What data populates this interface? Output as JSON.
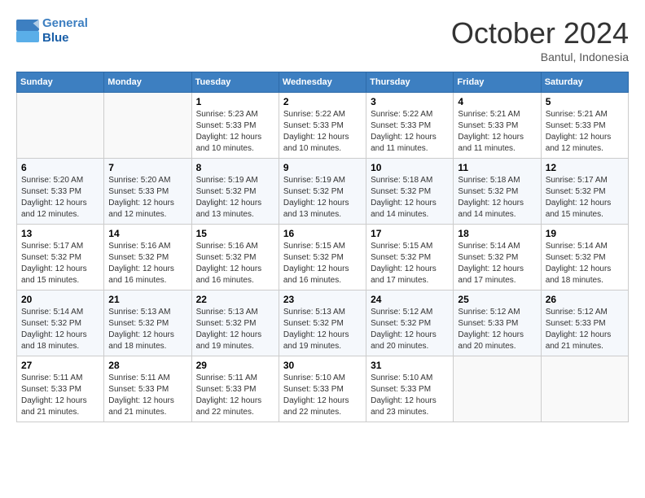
{
  "header": {
    "logo_line1": "General",
    "logo_line2": "Blue",
    "month": "October 2024",
    "location": "Bantul, Indonesia"
  },
  "days_of_week": [
    "Sunday",
    "Monday",
    "Tuesday",
    "Wednesday",
    "Thursday",
    "Friday",
    "Saturday"
  ],
  "weeks": [
    [
      {
        "day": "",
        "sunrise": "",
        "sunset": "",
        "daylight": ""
      },
      {
        "day": "",
        "sunrise": "",
        "sunset": "",
        "daylight": ""
      },
      {
        "day": "1",
        "sunrise": "Sunrise: 5:23 AM",
        "sunset": "Sunset: 5:33 PM",
        "daylight": "Daylight: 12 hours and 10 minutes."
      },
      {
        "day": "2",
        "sunrise": "Sunrise: 5:22 AM",
        "sunset": "Sunset: 5:33 PM",
        "daylight": "Daylight: 12 hours and 10 minutes."
      },
      {
        "day": "3",
        "sunrise": "Sunrise: 5:22 AM",
        "sunset": "Sunset: 5:33 PM",
        "daylight": "Daylight: 12 hours and 11 minutes."
      },
      {
        "day": "4",
        "sunrise": "Sunrise: 5:21 AM",
        "sunset": "Sunset: 5:33 PM",
        "daylight": "Daylight: 12 hours and 11 minutes."
      },
      {
        "day": "5",
        "sunrise": "Sunrise: 5:21 AM",
        "sunset": "Sunset: 5:33 PM",
        "daylight": "Daylight: 12 hours and 12 minutes."
      }
    ],
    [
      {
        "day": "6",
        "sunrise": "Sunrise: 5:20 AM",
        "sunset": "Sunset: 5:33 PM",
        "daylight": "Daylight: 12 hours and 12 minutes."
      },
      {
        "day": "7",
        "sunrise": "Sunrise: 5:20 AM",
        "sunset": "Sunset: 5:33 PM",
        "daylight": "Daylight: 12 hours and 12 minutes."
      },
      {
        "day": "8",
        "sunrise": "Sunrise: 5:19 AM",
        "sunset": "Sunset: 5:32 PM",
        "daylight": "Daylight: 12 hours and 13 minutes."
      },
      {
        "day": "9",
        "sunrise": "Sunrise: 5:19 AM",
        "sunset": "Sunset: 5:32 PM",
        "daylight": "Daylight: 12 hours and 13 minutes."
      },
      {
        "day": "10",
        "sunrise": "Sunrise: 5:18 AM",
        "sunset": "Sunset: 5:32 PM",
        "daylight": "Daylight: 12 hours and 14 minutes."
      },
      {
        "day": "11",
        "sunrise": "Sunrise: 5:18 AM",
        "sunset": "Sunset: 5:32 PM",
        "daylight": "Daylight: 12 hours and 14 minutes."
      },
      {
        "day": "12",
        "sunrise": "Sunrise: 5:17 AM",
        "sunset": "Sunset: 5:32 PM",
        "daylight": "Daylight: 12 hours and 15 minutes."
      }
    ],
    [
      {
        "day": "13",
        "sunrise": "Sunrise: 5:17 AM",
        "sunset": "Sunset: 5:32 PM",
        "daylight": "Daylight: 12 hours and 15 minutes."
      },
      {
        "day": "14",
        "sunrise": "Sunrise: 5:16 AM",
        "sunset": "Sunset: 5:32 PM",
        "daylight": "Daylight: 12 hours and 16 minutes."
      },
      {
        "day": "15",
        "sunrise": "Sunrise: 5:16 AM",
        "sunset": "Sunset: 5:32 PM",
        "daylight": "Daylight: 12 hours and 16 minutes."
      },
      {
        "day": "16",
        "sunrise": "Sunrise: 5:15 AM",
        "sunset": "Sunset: 5:32 PM",
        "daylight": "Daylight: 12 hours and 16 minutes."
      },
      {
        "day": "17",
        "sunrise": "Sunrise: 5:15 AM",
        "sunset": "Sunset: 5:32 PM",
        "daylight": "Daylight: 12 hours and 17 minutes."
      },
      {
        "day": "18",
        "sunrise": "Sunrise: 5:14 AM",
        "sunset": "Sunset: 5:32 PM",
        "daylight": "Daylight: 12 hours and 17 minutes."
      },
      {
        "day": "19",
        "sunrise": "Sunrise: 5:14 AM",
        "sunset": "Sunset: 5:32 PM",
        "daylight": "Daylight: 12 hours and 18 minutes."
      }
    ],
    [
      {
        "day": "20",
        "sunrise": "Sunrise: 5:14 AM",
        "sunset": "Sunset: 5:32 PM",
        "daylight": "Daylight: 12 hours and 18 minutes."
      },
      {
        "day": "21",
        "sunrise": "Sunrise: 5:13 AM",
        "sunset": "Sunset: 5:32 PM",
        "daylight": "Daylight: 12 hours and 18 minutes."
      },
      {
        "day": "22",
        "sunrise": "Sunrise: 5:13 AM",
        "sunset": "Sunset: 5:32 PM",
        "daylight": "Daylight: 12 hours and 19 minutes."
      },
      {
        "day": "23",
        "sunrise": "Sunrise: 5:13 AM",
        "sunset": "Sunset: 5:32 PM",
        "daylight": "Daylight: 12 hours and 19 minutes."
      },
      {
        "day": "24",
        "sunrise": "Sunrise: 5:12 AM",
        "sunset": "Sunset: 5:32 PM",
        "daylight": "Daylight: 12 hours and 20 minutes."
      },
      {
        "day": "25",
        "sunrise": "Sunrise: 5:12 AM",
        "sunset": "Sunset: 5:33 PM",
        "daylight": "Daylight: 12 hours and 20 minutes."
      },
      {
        "day": "26",
        "sunrise": "Sunrise: 5:12 AM",
        "sunset": "Sunset: 5:33 PM",
        "daylight": "Daylight: 12 hours and 21 minutes."
      }
    ],
    [
      {
        "day": "27",
        "sunrise": "Sunrise: 5:11 AM",
        "sunset": "Sunset: 5:33 PM",
        "daylight": "Daylight: 12 hours and 21 minutes."
      },
      {
        "day": "28",
        "sunrise": "Sunrise: 5:11 AM",
        "sunset": "Sunset: 5:33 PM",
        "daylight": "Daylight: 12 hours and 21 minutes."
      },
      {
        "day": "29",
        "sunrise": "Sunrise: 5:11 AM",
        "sunset": "Sunset: 5:33 PM",
        "daylight": "Daylight: 12 hours and 22 minutes."
      },
      {
        "day": "30",
        "sunrise": "Sunrise: 5:10 AM",
        "sunset": "Sunset: 5:33 PM",
        "daylight": "Daylight: 12 hours and 22 minutes."
      },
      {
        "day": "31",
        "sunrise": "Sunrise: 5:10 AM",
        "sunset": "Sunset: 5:33 PM",
        "daylight": "Daylight: 12 hours and 23 minutes."
      },
      {
        "day": "",
        "sunrise": "",
        "sunset": "",
        "daylight": ""
      },
      {
        "day": "",
        "sunrise": "",
        "sunset": "",
        "daylight": ""
      }
    ]
  ]
}
